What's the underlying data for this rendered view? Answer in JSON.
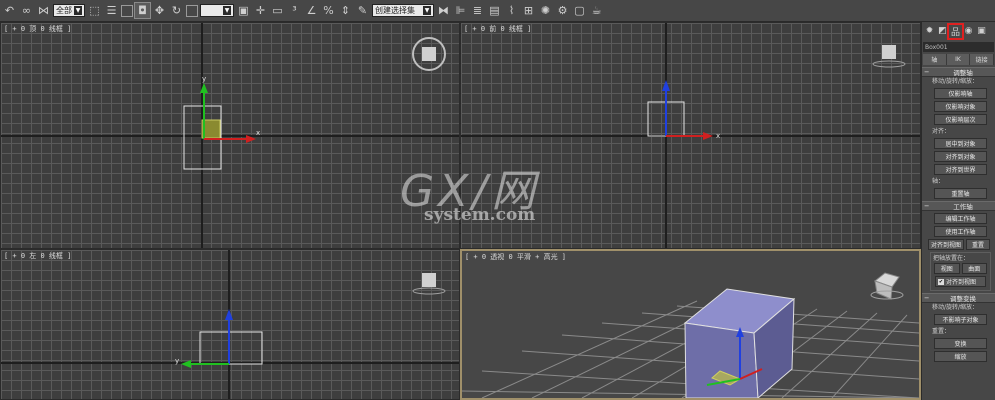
{
  "toolbar": {
    "selection_filter": "全部",
    "named_selection_set": "创建选择集",
    "icons": [
      "undo-icon",
      "link-icon",
      "unlink-icon",
      "bind-space-warp-icon",
      "select-object-icon",
      "select-by-name-icon",
      "rectangular-region-icon",
      "window-crossing-icon",
      "select-move-icon",
      "select-rotate-icon",
      "select-scale-icon",
      "reference-coordinate-icon",
      "pivot-center-icon",
      "select-manipulate-icon",
      "keyboard-shortcut-icon",
      "snap-3d-icon",
      "angle-snap-icon",
      "percent-snap-icon",
      "spinner-snap-icon",
      "edit-named-selection-icon",
      "mirror-icon",
      "align-icon",
      "toggle-layer-explorer-icon",
      "toggle-ribbon-icon",
      "curve-editor-icon",
      "schematic-view-icon",
      "material-editor-icon",
      "render-setup-icon",
      "rendered-frame-window-icon",
      "render-production-icon"
    ]
  },
  "viewports": {
    "top": {
      "label": "[ + 0 顶 0 线框 ]"
    },
    "front": {
      "label": "[ + 0 前 0 线框 ]"
    },
    "left": {
      "label": "[ + 0 左 0 线框 ]"
    },
    "perspective": {
      "label": "[ + 0 透视 0 平滑 + 高光 ]"
    }
  },
  "command_panel": {
    "tabs": [
      "create-tab-icon",
      "modify-tab-icon",
      "hierarchy-tab-icon",
      "motion-tab-icon",
      "display-tab-icon"
    ],
    "selected_tab": "hierarchy-tab-icon",
    "object_name": "Box001",
    "sub_tabs": {
      "pivot": "轴",
      "ik": "IK",
      "link_info": "链接"
    },
    "adjust_pivot": {
      "title": "调整轴",
      "move_rotate_scale": "移动/旋转/缩放：",
      "affect_pivot_only": "仅影响轴",
      "affect_object_only": "仅影响对象",
      "affect_hierarchy_only": "仅影响层次",
      "alignment": "对齐：",
      "center_to_object": "居中到对象",
      "align_to_object": "对齐到对象",
      "align_to_world": "对齐到世界",
      "pivot": "轴：",
      "reset_pivot": "重置轴"
    },
    "working_pivot": {
      "title": "工作轴",
      "edit_working_pivot": "编辑工作轴",
      "use_working_pivot": "使用工作轴",
      "align_to_view": "对齐到视图",
      "reset": "重置",
      "place_pivot_to": "把轴放置在：",
      "view": "视图",
      "surface": "曲面",
      "align_to_view_check": "对齐到视图"
    },
    "adjust_transform": {
      "title": "调整变换",
      "move_rotate_scale": "移动/旋转/缩放：",
      "dont_affect_children": "不影响子对象",
      "reset": "重置：",
      "transform": "变换",
      "scale": "缩放"
    }
  },
  "watermark": {
    "main": "GX/网",
    "sub": "system.com"
  }
}
